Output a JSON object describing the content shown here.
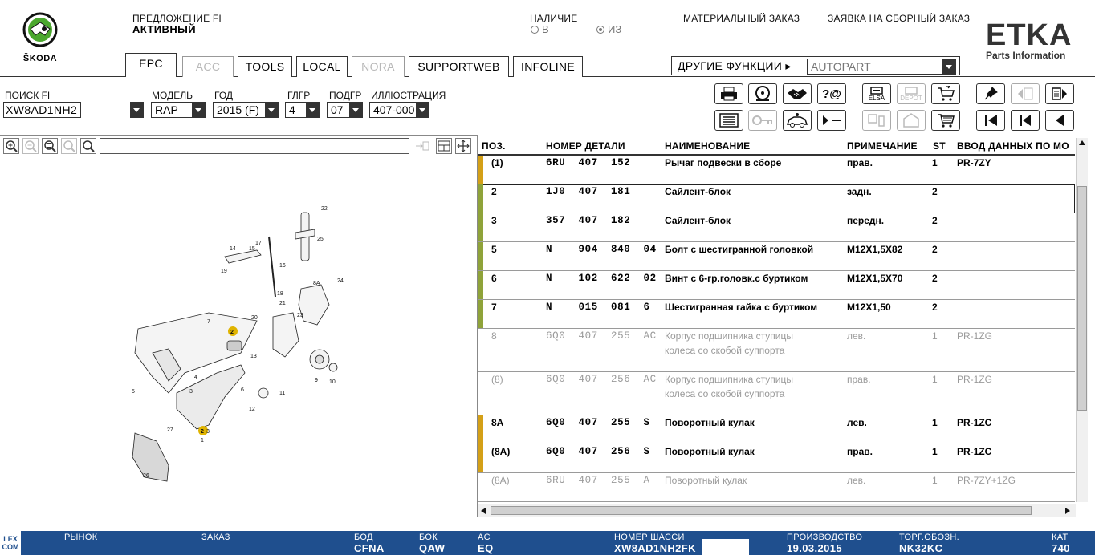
{
  "brand": {
    "skoda_text": "ŠKODA",
    "etka_title": "ETKA",
    "etka_sub": "Parts Information",
    "accent": "#1f4f8e"
  },
  "header": {
    "offer_label": "ПРЕДЛОЖЕНИЕ FI",
    "offer_value": "АКТИВНЫЙ",
    "availability_label": "НАЛИЧИЕ",
    "radio_in": "В",
    "radio_from": "ИЗ",
    "material_order": "МАТЕРИАЛЬНЫЙ ЗАКАЗ",
    "assembly_order": "ЗАЯВКА НА СБОРНЫЙ ЗАКАЗ"
  },
  "tabs": [
    {
      "label": "EPC",
      "state": "active"
    },
    {
      "label": "ACC",
      "state": "disabled"
    },
    {
      "label": "TOOLS",
      "state": "normal"
    },
    {
      "label": "LOCAL",
      "state": "normal"
    },
    {
      "label": "NORA",
      "state": "disabled"
    },
    {
      "label": "SUPPORTWEB",
      "state": "normal"
    },
    {
      "label": "INFOLINE",
      "state": "normal"
    }
  ],
  "other_functions": {
    "label": "ДРУГИЕ ФУНКЦИИ ▸",
    "value": "AUTOPART"
  },
  "search": {
    "fi_label": "ПОИСК FI",
    "fi_value": "XW8AD1NH2",
    "model_label": "МОДЕЛЬ",
    "model_value": "RAP",
    "year_label": "ГОД",
    "year_value": "2015 (F)",
    "mg_label": "ГЛГР",
    "mg_value": "4",
    "sg_label": "ПОДГР",
    "sg_value": "07",
    "ill_label": "ИЛЛЮСТРАЦИЯ",
    "ill_value": "407-000"
  },
  "toolbar": {
    "elsa": "ELSA",
    "depot": "DEPOT"
  },
  "table": {
    "headers": {
      "pos": "ПОЗ.",
      "part": "НОМЕР ДЕТАЛИ",
      "name": "НАИМЕНОВАНИЕ",
      "note": "ПРИМЕЧАНИЕ",
      "st": "ST",
      "input": "ВВОД ДАННЫХ ПО МО"
    },
    "rows": [
      {
        "pos": "(1)",
        "part": "6RU  407  152",
        "name": "Рычаг подвески в сборе",
        "name2": "",
        "note": "прав.",
        "st": "1",
        "input": "PR-7ZY",
        "marker": "#d4a017",
        "grey": false
      },
      {
        "pos": "2",
        "part": "1J0  407  181",
        "name": "Сайлент-блок",
        "name2": "",
        "note": "задн.",
        "st": "2",
        "input": "",
        "marker": "#8fa33a",
        "grey": false
      },
      {
        "pos": "3",
        "part": "357  407  182",
        "name": "Сайлент-блок",
        "name2": "",
        "note": "передн.",
        "st": "2",
        "input": "",
        "marker": "#8fa33a",
        "grey": false
      },
      {
        "pos": "5",
        "part": "N    904  840  04",
        "name": "Болт с шестигранной головкой",
        "name2": "",
        "note": "M12X1,5X82",
        "st": "2",
        "input": "",
        "marker": "#8fa33a",
        "grey": false
      },
      {
        "pos": "6",
        "part": "N    102  622  02",
        "name": "Винт с 6-гр.головк.с буртиком",
        "name2": "",
        "note": "M12X1,5X70",
        "st": "2",
        "input": "",
        "marker": "#8fa33a",
        "grey": false
      },
      {
        "pos": "7",
        "part": "N    015  081  6",
        "name": "Шестигранная гайка с буртиком",
        "name2": "",
        "note": "M12X1,50",
        "st": "2",
        "input": "",
        "marker": "#8fa33a",
        "grey": false
      },
      {
        "pos": "8",
        "part": "6Q0  407  255  AC",
        "name": "Корпус подшипника ступицы",
        "name2": "колеса со скобой суппорта",
        "note": "лев.",
        "st": "1",
        "input": "PR-1ZG",
        "marker": "",
        "grey": true
      },
      {
        "pos": "(8)",
        "part": "6Q0  407  256  AC",
        "name": "Корпус подшипника ступицы",
        "name2": "колеса со скобой суппорта",
        "note": "прав.",
        "st": "1",
        "input": "PR-1ZG",
        "marker": "",
        "grey": true
      },
      {
        "pos": "8A",
        "part": "6Q0  407  255  S",
        "name": "Поворотный кулак",
        "name2": "",
        "note": "лев.",
        "st": "1",
        "input": "PR-1ZC",
        "marker": "#d4a017",
        "grey": false
      },
      {
        "pos": "(8A)",
        "part": "6Q0  407  256  S",
        "name": "Поворотный кулак",
        "name2": "",
        "note": "прав.",
        "st": "1",
        "input": "PR-1ZC",
        "marker": "#d4a017",
        "grey": false
      },
      {
        "pos": "(8A)",
        "part": "6RU  407  255  A",
        "name": "Поворотный кулак",
        "name2": "",
        "note": "лев.",
        "st": "1",
        "input": "PR-7ZY+1ZG",
        "marker": "",
        "grey": true
      }
    ]
  },
  "diagram_labels": [
    "22",
    "25",
    "14",
    "17",
    "15",
    "16",
    "19",
    "8A",
    "24",
    "21",
    "20",
    "7",
    "23",
    "2",
    "18",
    "13",
    "9",
    "10",
    "11",
    "3",
    "4",
    "6",
    "5",
    "12",
    "27",
    "2",
    "3",
    "1",
    "26"
  ],
  "footer": {
    "logo": "LEX COM",
    "market_label": "РЫНОК",
    "order_label": "ЗАКАЗ",
    "bod_label": "БОД",
    "bod_value": "CFNA",
    "bok_label": "БОК",
    "bok_value": "QAW",
    "ac_label": "AC",
    "ac_value": "EQ",
    "chassis_label": "НОМЕР ШАССИ",
    "chassis_value": "XW8AD1NH2FK",
    "prod_label": "ПРОИЗВОДСТВО",
    "prod_value": "19.03.2015",
    "trade_label": "ТОРГ.ОБОЗН.",
    "trade_value": "NK32KC",
    "cat_label": "КАТ",
    "cat_value": "740"
  }
}
